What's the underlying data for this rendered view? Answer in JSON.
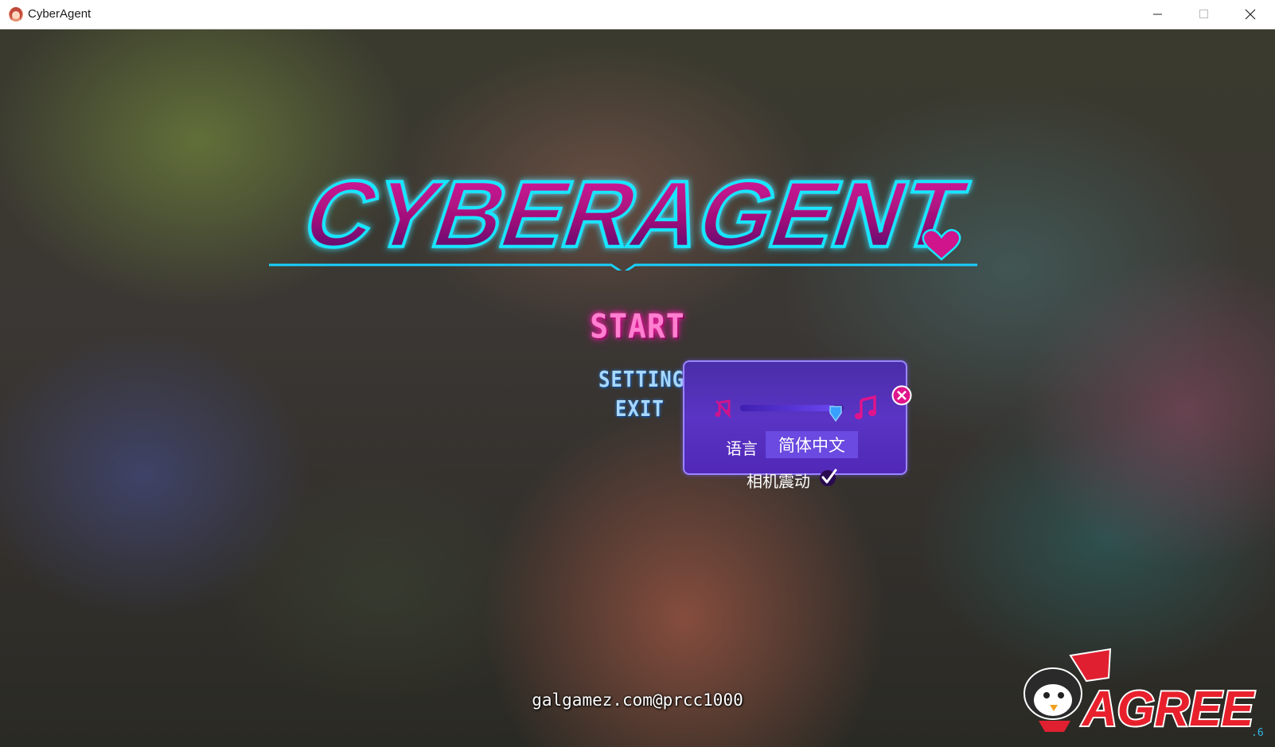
{
  "window": {
    "title": "CyberAgent",
    "controls": {
      "minimize": "minimize",
      "maximize": "maximize",
      "close": "close"
    }
  },
  "game": {
    "logo_text": "CYBERAGENT",
    "menu": {
      "start": "START",
      "setting": "SETTING",
      "exit": "EXIT"
    },
    "settings": {
      "volume_level": 0.92,
      "language_label": "语言",
      "language_value": "简体中文",
      "camera_shake_label": "相机震动",
      "camera_shake_enabled": true
    },
    "watermark": "galgamez.com@prcc1000",
    "publisher_logo": "AGREE",
    "version": ".6"
  },
  "colors": {
    "logo_magenta": "#c8148c",
    "logo_cyan": "#19e6ff",
    "start": "#ff7fd0",
    "menu_blue": "#a8d8ff",
    "panel": "#5a34c4",
    "accent_pink": "#e0148c"
  },
  "icons": {
    "app": "cyberagent-app-icon",
    "mute": "music-mute-icon",
    "music": "music-note-icon",
    "close": "close-icon",
    "check": "check-icon"
  }
}
